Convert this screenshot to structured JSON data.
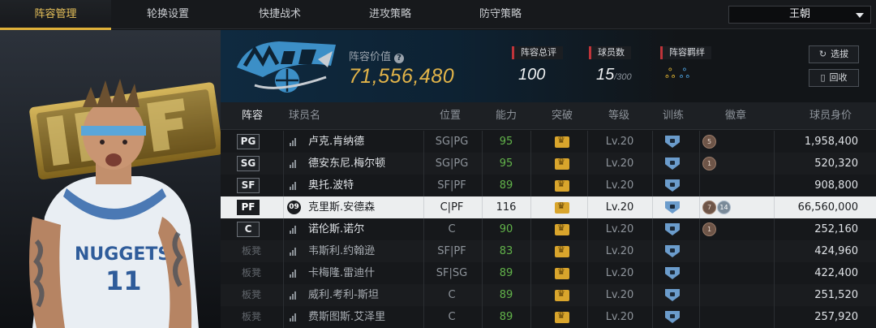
{
  "nav": {
    "tabs": [
      {
        "label": "阵容管理",
        "active": true
      },
      {
        "label": "轮换设置",
        "active": false
      },
      {
        "label": "快捷战术",
        "active": false
      },
      {
        "label": "进攻策略",
        "active": false
      },
      {
        "label": "防守策略",
        "active": false
      }
    ],
    "team_select": "王朝"
  },
  "info": {
    "lineup_value_label": "阵容价值",
    "lineup_value": "71,556,480",
    "rating_label": "阵容总评",
    "rating_value": "100",
    "players_label": "球员数",
    "players_value": "15",
    "players_max": "/300",
    "bond_label": "阵容羁绊",
    "select_button": "选拔",
    "recycle_button": "回收"
  },
  "table": {
    "headers": [
      "阵容",
      "球员名",
      "位置",
      "能力",
      "突破",
      "等级",
      "训练",
      "徽章",
      "球员身价"
    ],
    "rows": [
      {
        "slot": "PG",
        "name": "卢克.肯纳德",
        "position": "SG|PG",
        "ability": "95",
        "level": "Lv.20",
        "badges": [
          "5"
        ],
        "value": "1,958,400",
        "selected": false,
        "bench": false
      },
      {
        "slot": "SG",
        "name": "德安东尼.梅尔顿",
        "position": "SG|PG",
        "ability": "95",
        "level": "Lv.20",
        "badges": [
          "1"
        ],
        "value": "520,320",
        "selected": false,
        "bench": false
      },
      {
        "slot": "SF",
        "name": "奥托.波特",
        "position": "SF|PF",
        "ability": "89",
        "level": "Lv.20",
        "badges": [],
        "value": "908,800",
        "selected": false,
        "bench": false
      },
      {
        "slot": "PF",
        "name": "克里斯.安德森",
        "position": "C|PF",
        "ability": "116",
        "level": "Lv.20",
        "badges": [
          "7",
          "14"
        ],
        "value": "66,560,000",
        "selected": true,
        "bench": false,
        "jersey": "09"
      },
      {
        "slot": "C",
        "name": "诺伦斯.诺尔",
        "position": "C",
        "ability": "90",
        "level": "Lv.20",
        "badges": [
          "1"
        ],
        "value": "252,160",
        "selected": false,
        "bench": false
      },
      {
        "slot": "板凳",
        "name": "韦斯利.约翰逊",
        "position": "SF|PF",
        "ability": "83",
        "level": "Lv.20",
        "badges": [],
        "value": "424,960",
        "selected": false,
        "bench": true
      },
      {
        "slot": "板凳",
        "name": "卡梅隆.雷迪什",
        "position": "SF|SG",
        "ability": "89",
        "level": "Lv.20",
        "badges": [],
        "value": "422,400",
        "selected": false,
        "bench": true
      },
      {
        "slot": "板凳",
        "name": "威利.考利-斯坦",
        "position": "C",
        "ability": "89",
        "level": "Lv.20",
        "badges": [],
        "value": "251,520",
        "selected": false,
        "bench": true
      },
      {
        "slot": "板凳",
        "name": "费斯图斯.艾泽里",
        "position": "C",
        "ability": "89",
        "level": "Lv.20",
        "badges": [],
        "value": "257,920",
        "selected": false,
        "bench": true
      }
    ]
  },
  "colors": {
    "accent": "#e0b23a",
    "ability_green": "#62b34a",
    "stat_red": "#c0343a"
  }
}
